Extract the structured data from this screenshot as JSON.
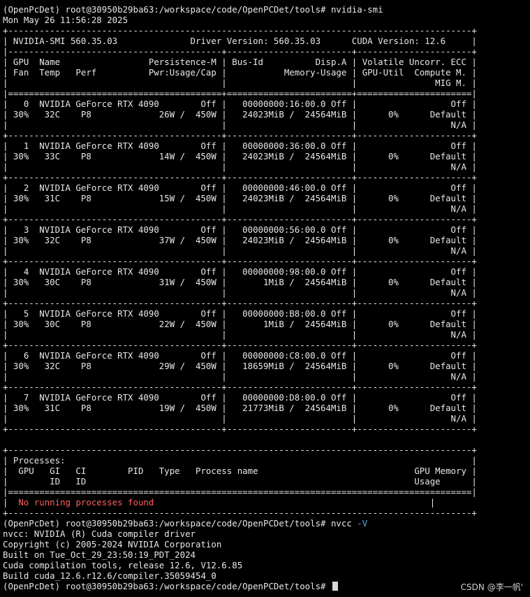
{
  "terminal": {
    "lines": [
      [
        {
          "t": "(OpenPcDet) root@30950b29ba63:/workspace/code/OpenPCDet/tools# nvidia-smi"
        }
      ],
      [
        {
          "t": "Mon May 26 11:56:28 2025"
        }
      ],
      [
        {
          "t": "+-----------------------------------------------------------------------------------------+"
        }
      ],
      [
        {
          "t": "| NVIDIA-SMI 560.35.03              Driver Version: 560.35.03      CUDA Version: 12.6     |"
        }
      ],
      [
        {
          "t": "|-----------------------------------------+------------------------+----------------------+"
        }
      ],
      [
        {
          "t": "| GPU  Name                 Persistence-M | Bus-Id          Disp.A | Volatile Uncorr. ECC |"
        }
      ],
      [
        {
          "t": "| Fan  Temp   Perf          Pwr:Usage/Cap |           Memory-Usage | GPU-Util  Compute M. |"
        }
      ],
      [
        {
          "t": "|                                         |                        |               MIG M. |"
        }
      ],
      [
        {
          "t": "|=========================================+========================+======================|"
        }
      ],
      [
        {
          "t": "|   0  NVIDIA GeForce RTX 4090        Off |   00000000:16:00.0 Off |                  Off |"
        }
      ],
      [
        {
          "t": "| 30%   32C    P8             26W /  450W |   24023MiB /  24564MiB |      0%      Default |"
        }
      ],
      [
        {
          "t": "|                                         |                        |                  N/A |"
        }
      ],
      [
        {
          "t": "+-----------------------------------------+------------------------+----------------------+"
        }
      ],
      [
        {
          "t": "|   1  NVIDIA GeForce RTX 4090        Off |   00000000:36:00.0 Off |                  Off |"
        }
      ],
      [
        {
          "t": "| 30%   33C    P8             14W /  450W |   24023MiB /  24564MiB |      0%      Default |"
        }
      ],
      [
        {
          "t": "|                                         |                        |                  N/A |"
        }
      ],
      [
        {
          "t": "+-----------------------------------------+------------------------+----------------------+"
        }
      ],
      [
        {
          "t": "|   2  NVIDIA GeForce RTX 4090        Off |   00000000:46:00.0 Off |                  Off |"
        }
      ],
      [
        {
          "t": "| 30%   31C    P8             15W /  450W |   24023MiB /  24564MiB |      0%      Default |"
        }
      ],
      [
        {
          "t": "|                                         |                        |                  N/A |"
        }
      ],
      [
        {
          "t": "+-----------------------------------------+------------------------+----------------------+"
        }
      ],
      [
        {
          "t": "|   3  NVIDIA GeForce RTX 4090        Off |   00000000:56:00.0 Off |                  Off |"
        }
      ],
      [
        {
          "t": "| 30%   32C    P8             37W /  450W |   24023MiB /  24564MiB |      0%      Default |"
        }
      ],
      [
        {
          "t": "|                                         |                        |                  N/A |"
        }
      ],
      [
        {
          "t": "+-----------------------------------------+------------------------+----------------------+"
        }
      ],
      [
        {
          "t": "|   4  NVIDIA GeForce RTX 4090        Off |   00000000:98:00.0 Off |                  Off |"
        }
      ],
      [
        {
          "t": "| 30%   30C    P8             31W /  450W |       1MiB /  24564MiB |      0%      Default |"
        }
      ],
      [
        {
          "t": "|                                         |                        |                  N/A |"
        }
      ],
      [
        {
          "t": "+-----------------------------------------+------------------------+----------------------+"
        }
      ],
      [
        {
          "t": "|   5  NVIDIA GeForce RTX 4090        Off |   00000000:B8:00.0 Off |                  Off |"
        }
      ],
      [
        {
          "t": "| 30%   30C    P8             22W /  450W |       1MiB /  24564MiB |      0%      Default |"
        }
      ],
      [
        {
          "t": "|                                         |                        |                  N/A |"
        }
      ],
      [
        {
          "t": "+-----------------------------------------+------------------------+----------------------+"
        }
      ],
      [
        {
          "t": "|   6  NVIDIA GeForce RTX 4090        Off |   00000000:C8:00.0 Off |                  Off |"
        }
      ],
      [
        {
          "t": "| 30%   32C    P8             29W /  450W |   18659MiB /  24564MiB |      0%      Default |"
        }
      ],
      [
        {
          "t": "|                                         |                        |                  N/A |"
        }
      ],
      [
        {
          "t": "+-----------------------------------------+------------------------+----------------------+"
        }
      ],
      [
        {
          "t": "|   7  NVIDIA GeForce RTX 4090        Off |   00000000:D8:00.0 Off |                  Off |"
        }
      ],
      [
        {
          "t": "| 30%   31C    P8             19W /  450W |   21773MiB /  24564MiB |      0%      Default |"
        }
      ],
      [
        {
          "t": "|                                         |                        |                  N/A |"
        }
      ],
      [
        {
          "t": "+-----------------------------------------+------------------------+----------------------+"
        }
      ],
      [
        {
          "t": ""
        }
      ],
      [
        {
          "t": "+-----------------------------------------------------------------------------------------+"
        }
      ],
      [
        {
          "t": "| Processes:                                                                              |"
        }
      ],
      [
        {
          "t": "|  GPU   GI   CI        PID   Type   Process name                              GPU Memory |"
        }
      ],
      [
        {
          "t": "|        ID   ID                                                               Usage      |"
        }
      ],
      [
        {
          "t": "|=========================================================================================|"
        }
      ],
      [
        {
          "t": "|  "
        },
        {
          "t": "No running processes found",
          "c": "red"
        },
        {
          "t": "                                                     |"
        }
      ],
      [
        {
          "t": "+-----------------------------------------------------------------------------------------+"
        }
      ],
      [
        {
          "t": "(OpenPcDet) root@30950b29ba63:/workspace/code/OpenPCDet/tools# nvcc "
        },
        {
          "t": "-V",
          "c": "cyan"
        }
      ],
      [
        {
          "t": "nvcc: NVIDIA (R) Cuda compiler driver"
        }
      ],
      [
        {
          "t": "Copyright (c) 2005-2024 NVIDIA Corporation"
        }
      ],
      [
        {
          "t": "Built on Tue_Oct_29_23:50:19_PDT_2024"
        }
      ],
      [
        {
          "t": "Cuda compilation tools, release 12.6, V12.6.85"
        }
      ],
      [
        {
          "t": "Build cuda_12.6.r12.6/compiler.35059454_0"
        }
      ],
      [
        {
          "t": "(OpenPcDet) root@30950b29ba63:/workspace/code/OpenPCDet/tools# "
        }
      ]
    ]
  },
  "watermark": "CSDN @李一帆'"
}
